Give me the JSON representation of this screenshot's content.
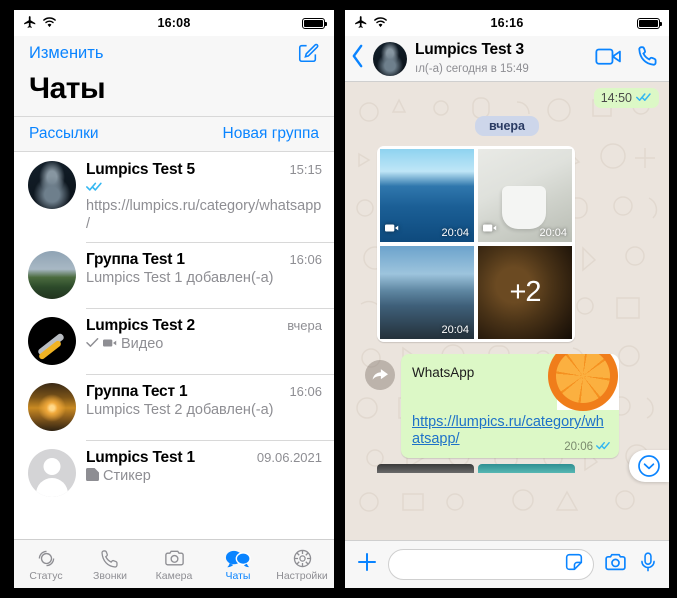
{
  "left_phone": {
    "status_bar": {
      "airplane_icon": "airplane-icon",
      "wifi_icon": "wifi-icon",
      "time": "16:08",
      "battery_icon": "battery-full-icon"
    },
    "nav": {
      "edit_label": "Изменить",
      "compose_icon": "compose-icon",
      "title": "Чаты"
    },
    "subnav": {
      "broadcasts_label": "Рассылки",
      "new_group_label": "Новая группа"
    },
    "chats": [
      {
        "name": "Lumpics Test 5",
        "time": "15:15",
        "status_icon": "double-check-blue-icon",
        "preview": "https://lumpics.ru/category/whatsapp/",
        "avatar": "hooded-figure-avatar"
      },
      {
        "name": "Группа Test 1",
        "time": "16:06",
        "status_icon": "",
        "preview": "Lumpics Test 1 добавлен(-а)",
        "avatar": "storm-landscape-avatar"
      },
      {
        "name": "Lumpics Test 2",
        "time": "вчера",
        "status_icon": "single-check-icon",
        "attachment_icon": "video-camera-icon",
        "preview": "Видео",
        "avatar": "tools-avatar"
      },
      {
        "name": "Группа Тест 1",
        "time": "16:06",
        "status_icon": "",
        "preview": "Lumpics Test 2 добавлен(-а)",
        "avatar": "sunset-avatar"
      },
      {
        "name": "Lumpics Test 1",
        "time": "09.06.2021",
        "status_icon": "",
        "attachment_icon": "sticker-icon",
        "preview": "Стикер",
        "avatar": "blank-person-avatar"
      }
    ],
    "tabs": [
      {
        "label": "Статус",
        "icon": "status-circles-icon",
        "active": false
      },
      {
        "label": "Звонки",
        "icon": "phone-icon",
        "active": false
      },
      {
        "label": "Камера",
        "icon": "camera-icon",
        "active": false
      },
      {
        "label": "Чаты",
        "icon": "chats-bubbles-icon",
        "active": true
      },
      {
        "label": "Настройки",
        "icon": "gear-icon",
        "active": false
      }
    ]
  },
  "right_phone": {
    "status_bar": {
      "airplane_icon": "airplane-icon",
      "wifi_icon": "wifi-icon",
      "time": "16:16",
      "battery_icon": "battery-full-icon"
    },
    "nav": {
      "back_icon": "chevron-left-icon",
      "avatar": "hooded-figure-avatar",
      "contact_name": "Lumpics Test 3",
      "contact_status": "ıл(-а) сегодня в 15:49",
      "video_call_icon": "video-call-icon",
      "voice_call_icon": "phone-call-icon"
    },
    "conversation": {
      "top_bubble": {
        "time": "14:50",
        "status_icon": "double-check-blue-icon"
      },
      "day_separator": "вчера",
      "album": {
        "cells": [
          {
            "time": "20:04",
            "video_icon": "video-camera-icon",
            "thumb": "seaside-blue-thumb"
          },
          {
            "time": "20:04",
            "video_icon": "video-camera-icon",
            "thumb": "white-mug-thumb"
          },
          {
            "time": "20:04",
            "video_icon": "",
            "thumb": "blurred-city-thumb"
          },
          {
            "time": "",
            "video_icon": "",
            "thumb": "dark-amber-thumb",
            "overlay": "+2"
          }
        ]
      },
      "forwarded_message": {
        "forward_icon": "forward-arrow-icon",
        "text": "WhatsApp",
        "sticker": "orange-slice-sticker",
        "link": "https://lumpics.ru/category/whatsapp/",
        "time": "20:06",
        "status_icon": "double-check-blue-icon"
      },
      "scroll_down_icon": "chevron-down-circle-icon"
    },
    "composer": {
      "attach_icon": "plus-icon",
      "input_placeholder": "",
      "input_value": "",
      "sticker_icon": "sticker-icon",
      "camera_icon": "camera-icon",
      "mic_icon": "microphone-icon"
    }
  },
  "colors": {
    "ios_blue": "#0a84ff",
    "bubble_green": "#dcf8c6",
    "chat_bg": "#ebe4dd",
    "day_badge": "#cdd6ea",
    "link_blue": "#1e72c8",
    "secondary_text": "#8e8e93"
  }
}
